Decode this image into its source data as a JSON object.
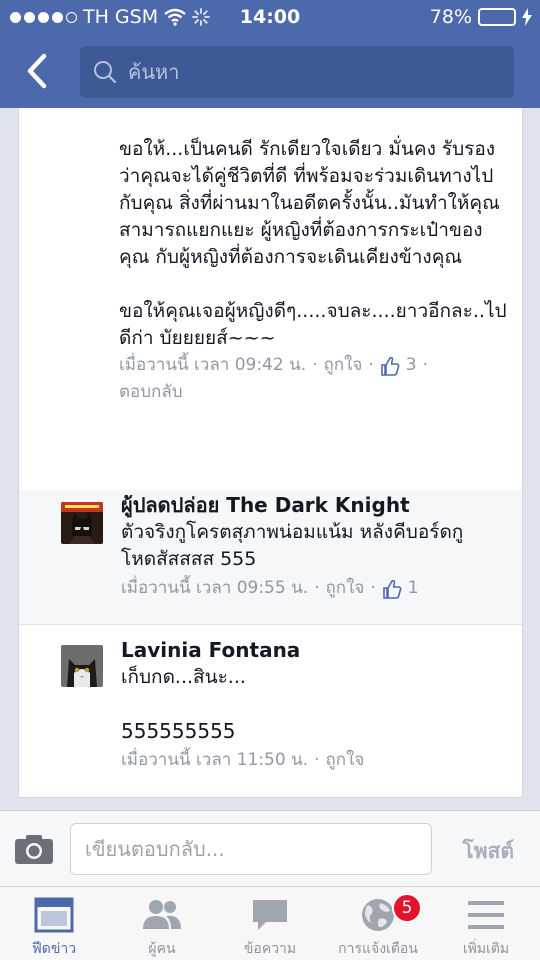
{
  "status_bar": {
    "carrier": "TH GSM",
    "time": "14:00",
    "battery": "78%",
    "battery_level": 0.78
  },
  "header": {
    "back_icon": "chevron-left-icon",
    "search_placeholder": "ค้นหา"
  },
  "main_comment": {
    "paragraphs": [
      "ขอให้...เป็นคนดี รักเดียวใจเดียว มั่นคง รับรองว่าคุณจะได้คู่ชีวิตที่ดี ที่พร้อมจะร่วมเดินทางไปกับคุณ สิ่งที่ผ่านมาในอดีตครั้งนั้น..มันทำให้คุณสามารถแยกแยะ ผู้หญิงที่ต้องการกระเป๋าของคุณ กับผู้หญิงที่ต้องการจะเดินเคียงข้างคุณ",
      "ขอให้คุณเจอผู้หญิงดีๆ.....จบละ....ยาวอีกละ..ไปดีก่า บัยยยยส์~~~"
    ],
    "timestamp": "เมื่อวานนี้ เวลา 09:42 น.",
    "like_label": "ถูกใจ",
    "like_count": "3",
    "reply_label": "ตอบกลับ"
  },
  "comments": [
    {
      "author": "ผู้ปลดปล่อย The Dark Knight",
      "text_lines": [
        "ตัวจริงกูโครตสุภาพน่อมแน้ม หลังคีบอร์ดกู",
        "โหดสัสสสส 555"
      ],
      "timestamp": "เมื่อวานนี้ เวลา 09:55 น.",
      "like_label": "ถูกใจ",
      "like_count": "1"
    },
    {
      "author": "Lavinia Fontana",
      "text_lines": [
        "เก็บกด...สินะ...",
        "",
        "555555555"
      ],
      "timestamp": "เมื่อวานนี้ เวลา 11:50 น.",
      "like_label": "ถูกใจ"
    }
  ],
  "composer": {
    "placeholder": "เขียนตอบกลับ...",
    "post_label": "โพสต์",
    "camera_icon": "camera-icon"
  },
  "tabs": [
    {
      "label": "ฟีดข่าว",
      "icon": "news-feed-icon",
      "active": true
    },
    {
      "label": "ผู้คน",
      "icon": "people-icon",
      "active": false
    },
    {
      "label": "ข้อความ",
      "icon": "message-icon",
      "active": false
    },
    {
      "label": "การแจ้งเตือน",
      "icon": "globe-icon",
      "active": false,
      "badge": "5"
    },
    {
      "label": "เพิ่มเติม",
      "icon": "menu-icon",
      "active": false
    }
  ],
  "colors": {
    "brand": "#4c6aab",
    "like": "#4c6aab",
    "badge": "#e3142a",
    "battery": "#4cd964"
  }
}
